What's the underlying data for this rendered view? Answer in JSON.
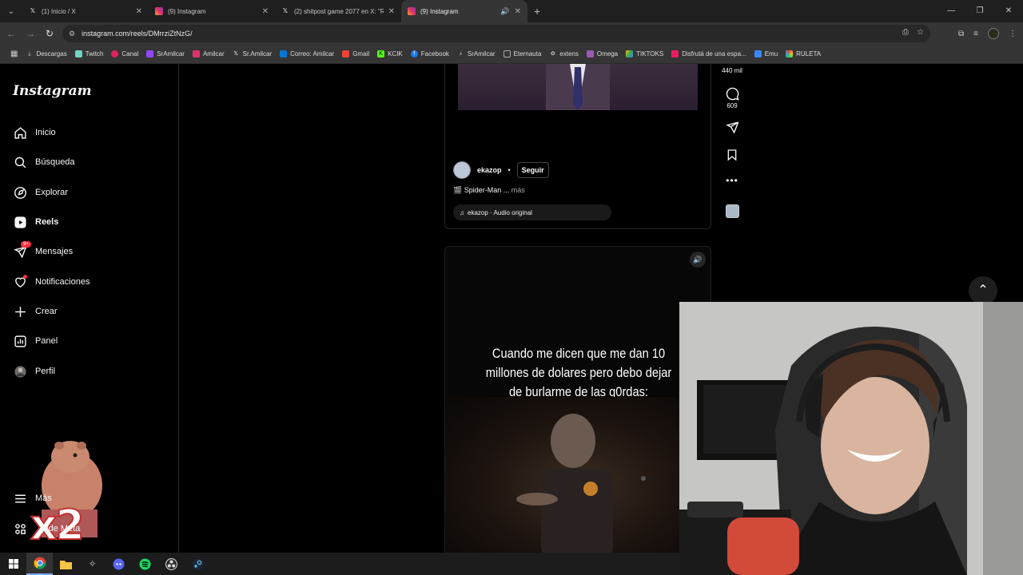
{
  "browser": {
    "tabs": [
      {
        "title": "(1) Inicio / X",
        "favicon": "x-icon",
        "active": false
      },
      {
        "title": "(9) Instagram",
        "favicon": "instagram-icon",
        "active": false
      },
      {
        "title": "(2) shitpost game 2077 en X: \"R",
        "favicon": "x-icon",
        "active": false
      },
      {
        "title": "(9) Instagram",
        "favicon": "instagram-icon",
        "active": true
      }
    ],
    "url": "instagram.com/reels/DMrrziZtNzG/",
    "bookmarks": [
      {
        "label": "Descargas",
        "color": "#aaaaaa"
      },
      {
        "label": "Twitch",
        "color": "#6fd4c4"
      },
      {
        "label": "Canal",
        "color": "#e0245e"
      },
      {
        "label": "SrAmilcar",
        "color": "#9146ff"
      },
      {
        "label": "Amilcar",
        "color": "#e1306c"
      },
      {
        "label": "Sr.Amilcar",
        "color": "#222222"
      },
      {
        "label": "Correo: Amilcar",
        "color": "#0078d4"
      },
      {
        "label": "Gmail",
        "color": "#ea4335"
      },
      {
        "label": "KCIK",
        "color": "#53fc18"
      },
      {
        "label": "Facebook",
        "color": "#1877f2"
      },
      {
        "label": "SrAmilcar",
        "color": "#111111"
      },
      {
        "label": "Eternauta",
        "color": "#555555"
      },
      {
        "label": "extens",
        "color": "#888888"
      },
      {
        "label": "Omega",
        "color": "#9b59b6"
      },
      {
        "label": "TIKTOKS",
        "color": "#2ecc71"
      },
      {
        "label": "Disfrutá de una espa...",
        "color": "#e91e63"
      },
      {
        "label": "Emu",
        "color": "#3a86ff"
      },
      {
        "label": "RULETA",
        "color": "#e74c3c"
      }
    ]
  },
  "sidebar": {
    "logo": "Instagram",
    "items": [
      {
        "label": "Inicio",
        "icon": "home-icon"
      },
      {
        "label": "Búsqueda",
        "icon": "search-icon"
      },
      {
        "label": "Explorar",
        "icon": "compass-icon"
      },
      {
        "label": "Reels",
        "icon": "reels-icon"
      },
      {
        "label": "Mensajes",
        "icon": "messenger-icon",
        "badge": "9+"
      },
      {
        "label": "Notificaciones",
        "icon": "heart-icon"
      },
      {
        "label": "Crear",
        "icon": "plus-icon"
      },
      {
        "label": "Panel",
        "icon": "chart-icon"
      },
      {
        "label": "Perfil",
        "icon": "avatar-icon"
      }
    ],
    "more_label": "Más",
    "meta_label": "pide Meta",
    "overlay_text": "x2"
  },
  "reel1": {
    "username": "ekazop",
    "separator": "•",
    "follow_label": "Seguir",
    "caption": "🎬 Spider-Man ...",
    "caption_more": "más",
    "audio": "ekazop · Audio original"
  },
  "actions": {
    "likes": "440 mil",
    "comments": "609"
  },
  "reel2": {
    "meme_lines": [
      "Cuando me dicen que me dan 10",
      "millones de dolares pero debo dejar",
      "de burlarme de las g0rdas:"
    ]
  },
  "colors": {
    "accent": "#ff3040",
    "background": "#000000"
  }
}
